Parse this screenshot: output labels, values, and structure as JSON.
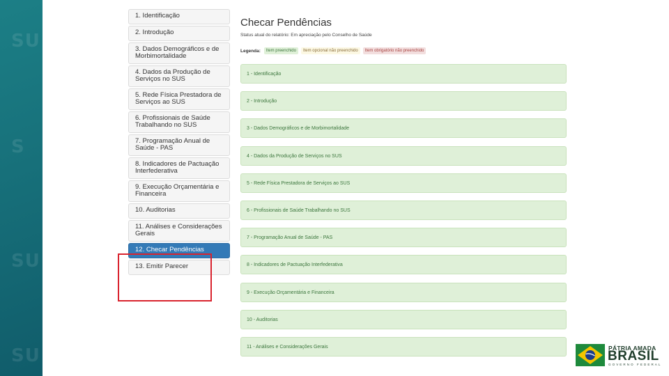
{
  "sidebar": {
    "items": [
      {
        "label": "1. Identificação",
        "active": false
      },
      {
        "label": "2. Introdução",
        "active": false
      },
      {
        "label": "3. Dados Demográficos e de Morbimortalidade",
        "active": false
      },
      {
        "label": "4. Dados da Produção de Serviços no SUS",
        "active": false
      },
      {
        "label": "5. Rede Física Prestadora de Serviços ao SUS",
        "active": false
      },
      {
        "label": "6. Profissionais de Saúde Trabalhando no SUS",
        "active": false
      },
      {
        "label": "7. Programação Anual de Saúde - PAS",
        "active": false
      },
      {
        "label": "8. Indicadores de Pactuação Interfederativa",
        "active": false
      },
      {
        "label": "9. Execução Orçamentária e Financeira",
        "active": false
      },
      {
        "label": "10. Auditorias",
        "active": false
      },
      {
        "label": "11. Análises e Considerações Gerais",
        "active": false
      },
      {
        "label": "12. Checar Pendências",
        "active": true
      },
      {
        "label": "13. Emitir Parecer",
        "active": false
      }
    ]
  },
  "main": {
    "title": "Checar Pendências",
    "status": "Status atual do relatório: Em apreciação pelo Conselho de Saúde",
    "legend": {
      "label": "Legenda:",
      "items": [
        {
          "label": "Item preenchido",
          "color": "#dff0d8"
        },
        {
          "label": "Item opcional não preenchido",
          "color": "#fcf8e3"
        },
        {
          "label": "Item obrigatório não preenchido",
          "color": "#f2dede"
        }
      ]
    },
    "panels": [
      "1 - Identificação",
      "2 - Introdução",
      "3 - Dados Demográficos e de Morbimortalidade",
      "4 - Dados da Produção de Serviços no SUS",
      "5 - Rede Física Prestadora de Serviços ao SUS",
      "6 - Profissionais de Saúde Trabalhando no SUS",
      "7 - Programação Anual de Saúde - PAS",
      "8 - Indicadores de Pactuação Interfederativa",
      "9 - Execução Orçamentária e Financeira",
      "10 - Auditorias",
      "11 - Análises e Considerações Gerais"
    ]
  },
  "logo": {
    "line1": "PÁTRIA AMADA",
    "line2": "BRASIL",
    "line3": "GOVERNO FEDERAL"
  },
  "colors": {
    "active": "#337ab7",
    "highlight": "#d9232e",
    "completed": "#dff0d8",
    "strip": "#17707a"
  }
}
